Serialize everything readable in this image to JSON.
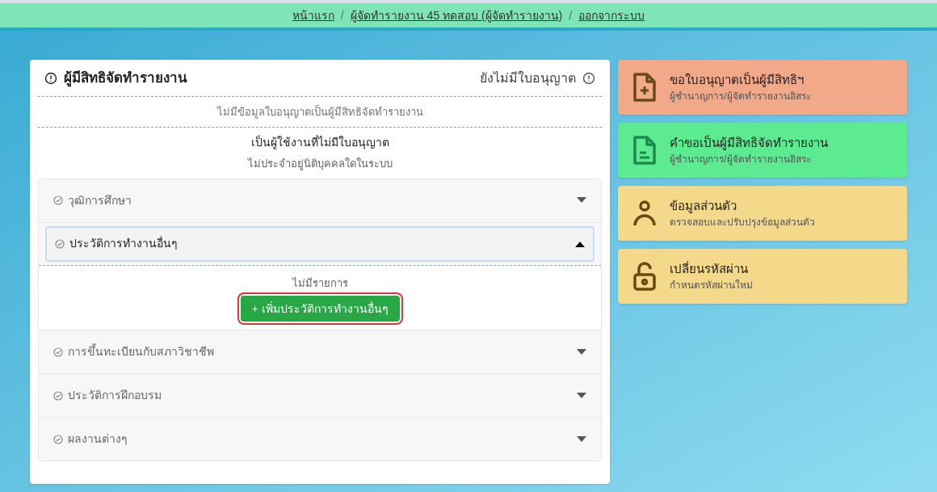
{
  "breadcrumb": [
    {
      "kind": "link",
      "text": "หน้าแรก"
    },
    {
      "kind": "separator",
      "text": "/"
    },
    {
      "kind": "link",
      "text": "ผู้จัดทำรายงาน 45 ทดสอบ (ผู้จัดทำรายงาน)"
    },
    {
      "kind": "separator",
      "text": "/"
    },
    {
      "kind": "link",
      "text": "ออกจากระบบ"
    }
  ],
  "profile": {
    "title": "ผู้มีสิทธิจัดทำรายงาน",
    "license_status": "ยังไม่มีใบอนุญาต",
    "license_note": "ไม่มีข้อมูลใบอนุญาตเป็นผู้มีสิทธิจัดทำรายงาน",
    "user_status": "เป็นผู้ใช้งานที่ไม่มีใบอนุญาต",
    "org_status": "ไม่ประจำอยู่นิติบุคคลใดในระบบ",
    "sections": [
      {
        "label": "วุฒิการศึกษา",
        "expanded": false
      },
      {
        "label": "ประวัติการทำงานอื่นๆ",
        "expanded": true,
        "empty_text": "ไม่มีรายการ",
        "add_button": "+ เพิ่มประวัติการทำงานอื่นๆ"
      },
      {
        "label": "การขึ้นทะเบียนกับสภาวิชาชีพ",
        "expanded": false
      },
      {
        "label": "ประวัติการฝึกอบรม",
        "expanded": false
      },
      {
        "label": "ผลงานต่างๆ",
        "expanded": false
      }
    ]
  },
  "actions": [
    {
      "kind": "file-plus",
      "title": "ขอใบอนุญาตเป็นผู้มีสิทธิฯ",
      "subtitle": "ผู้ชำนาญการ/ผู้จัดทำรายงานอิสระ",
      "color": "#f2a98a"
    },
    {
      "kind": "file",
      "title": "คำขอเป็นผู้มีสิทธิจัดทำรายงาน",
      "subtitle": "ผู้ชำนาญการ/ผู้จัดทำรายงานอิสระ",
      "color": "#5ceb91"
    },
    {
      "kind": "user",
      "title": "ข้อมูลส่วนตัว",
      "subtitle": "ตรวจสอบและปรับปรุงข้อมูลส่วนตัว",
      "color": "#f5d98a"
    },
    {
      "kind": "unlock",
      "title": "เปลี่ยนรหัสผ่าน",
      "subtitle": "กำหนดรหัสผ่านใหม่",
      "color": "#f5d98a"
    }
  ]
}
